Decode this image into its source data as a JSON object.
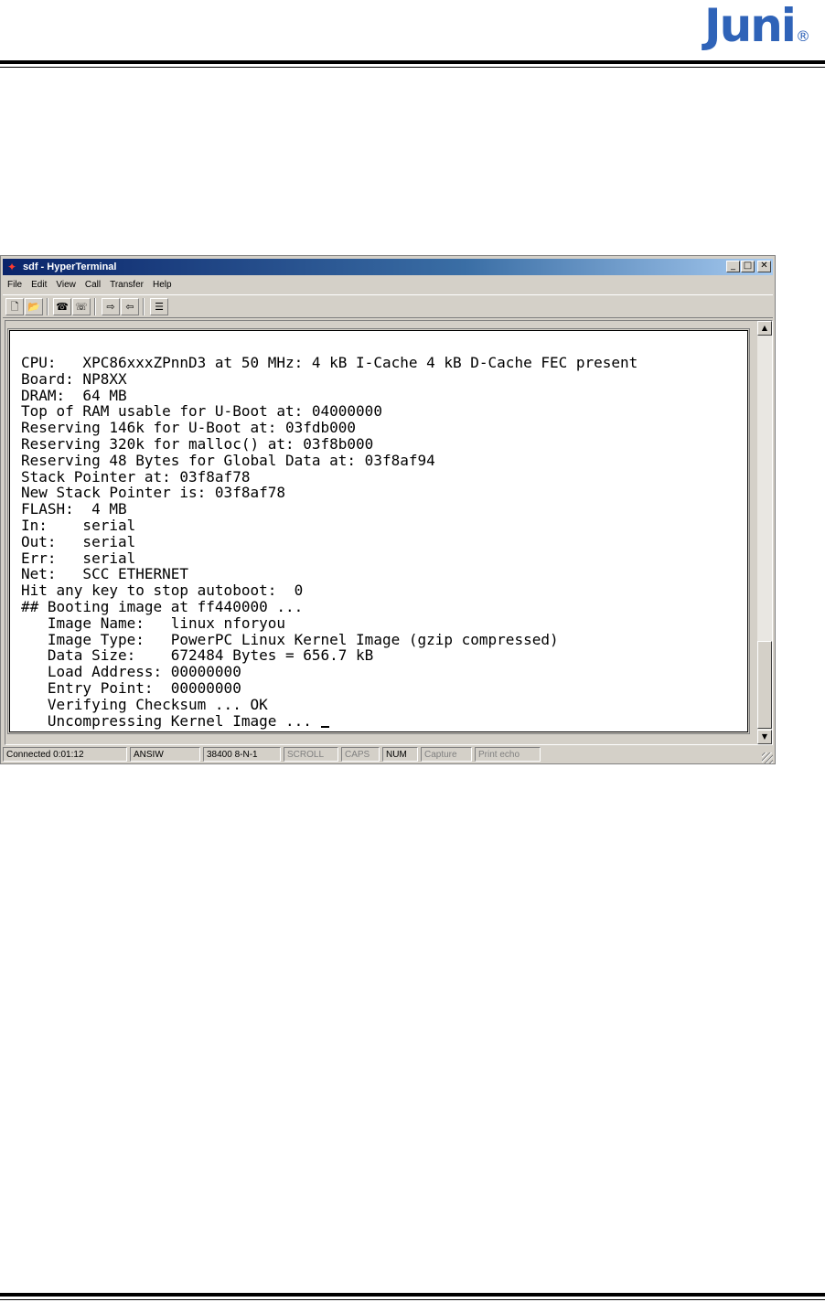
{
  "logo": {
    "text": "Juni",
    "mark": "®"
  },
  "window": {
    "title": "sdf - HyperTerminal",
    "title_icon": "hyperterminal-icon",
    "menu": [
      "File",
      "Edit",
      "View",
      "Call",
      "Transfer",
      "Help"
    ],
    "toolbar_icons": [
      "new-icon",
      "open-icon",
      "connect-icon",
      "disconnect-icon",
      "send-icon",
      "receive-icon",
      "properties-icon"
    ]
  },
  "terminal": {
    "lines": [
      "CPU:   XPC86xxxZPnnD3 at 50 MHz: 4 kB I-Cache 4 kB D-Cache FEC present",
      "Board: NP8XX",
      "DRAM:  64 MB",
      "Top of RAM usable for U-Boot at: 04000000",
      "Reserving 146k for U-Boot at: 03fdb000",
      "Reserving 320k for malloc() at: 03f8b000",
      "Reserving 48 Bytes for Global Data at: 03f8af94",
      "Stack Pointer at: 03f8af78",
      "New Stack Pointer is: 03f8af78",
      "FLASH:  4 MB",
      "In:    serial",
      "Out:   serial",
      "Err:   serial",
      "Net:   SCC ETHERNET",
      "Hit any key to stop autoboot:  0",
      "## Booting image at ff440000 ...",
      "   Image Name:   linux nforyou",
      "   Image Type:   PowerPC Linux Kernel Image (gzip compressed)",
      "   Data Size:    672484 Bytes = 656.7 kB",
      "   Load Address: 00000000",
      "   Entry Point:  00000000",
      "   Verifying Checksum ... OK",
      "   Uncompressing Kernel Image ... "
    ]
  },
  "statusbar": {
    "connected": "Connected 0:01:12",
    "emulation": "ANSIW",
    "port": "38400 8-N-1",
    "scroll": "SCROLL",
    "caps": "CAPS",
    "num": "NUM",
    "capture": "Capture",
    "print_echo": "Print echo"
  }
}
